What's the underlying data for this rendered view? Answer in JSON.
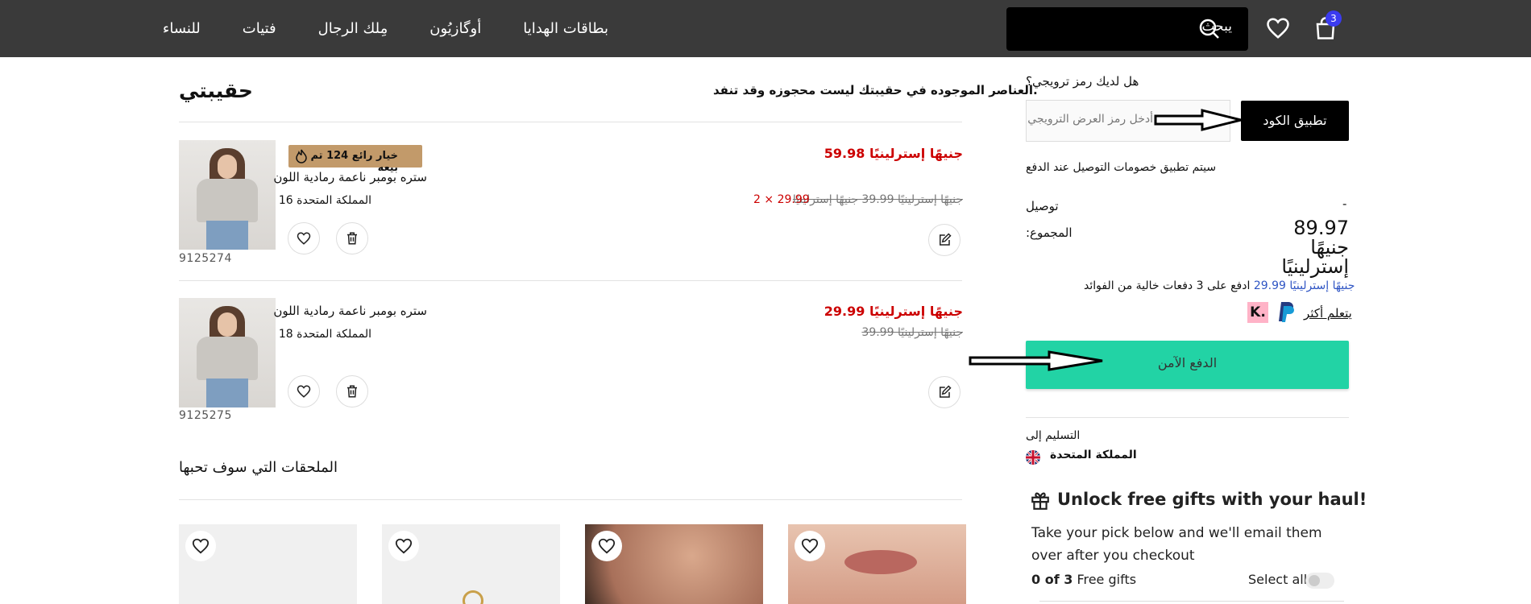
{
  "header": {
    "nav": [
      "بطاقات الهدايا",
      "أوگازيُون",
      "مِلك الرجال",
      "فتيات",
      "للنساء"
    ],
    "search_placeholder": "يبحث",
    "bag_count": "3"
  },
  "bag": {
    "title": "حقيبتي",
    "notice": ".العناصر الموجوده في حقيبتك ليست محجوزه وقد تنفد"
  },
  "items": [
    {
      "badge": "خيار رائع 124 تم بيعه",
      "name": "ستره بومبر ناعمة رمادية اللون",
      "size": "المملكة المتحدة 16",
      "price": "جنيهًا إسترلينيًا 59.98",
      "old_price": "جنيهًا إسترلينيًا 39.99 جنيهًا إسترلينيًا",
      "unit_qty": "29.99 × 2",
      "code": "9125274"
    },
    {
      "name": "ستره بومبر ناعمة رمادية اللون",
      "size": "المملكة المتحدة 18",
      "price": "جنيهًا إسترلينيًا 29.99",
      "old_price": "جنيهًا إسترلينيًا 39.99",
      "code": "9125275"
    }
  ],
  "accessories": {
    "title": "الملحقات التي سوف تحبها"
  },
  "summary": {
    "promo_question": "هل لديك رمز ترويجي؟",
    "promo_placeholder": "أدخل رمز العرض الترويجي",
    "apply_label": "تطبيق الكود",
    "shipping_note": "سيتم تطبيق خصومات التوصيل عند الدفع",
    "delivery_label": "توصيل",
    "delivery_value": "-",
    "total_label": "المجموع:",
    "total_value": "89.97 جنيهًا إسترلينيًا",
    "installment_amount": "جنيهًا إسترلينيًا 29.99",
    "installment_text": "ادفع على 3 دفعات خالية من الفوائد",
    "learn_more": "يتعلم أكثر",
    "klarna": "K.",
    "pay_label": "الدفع الآمن",
    "deliver_to": "التسليم إلى",
    "country": "المملكة المتحدة"
  },
  "gifts": {
    "title": "Unlock free gifts with your haul!",
    "desc": "Take your pick below and we'll email them over after you checkout",
    "count_prefix": "0 of 3",
    "count_suffix": " Free gifts",
    "select_all": "Select all"
  },
  "colors": {
    "header_bg": "#3a3a3a",
    "accent_green": "#22d3a5",
    "price_red": "#cc0000",
    "badge_blue": "#3b3bf0"
  }
}
